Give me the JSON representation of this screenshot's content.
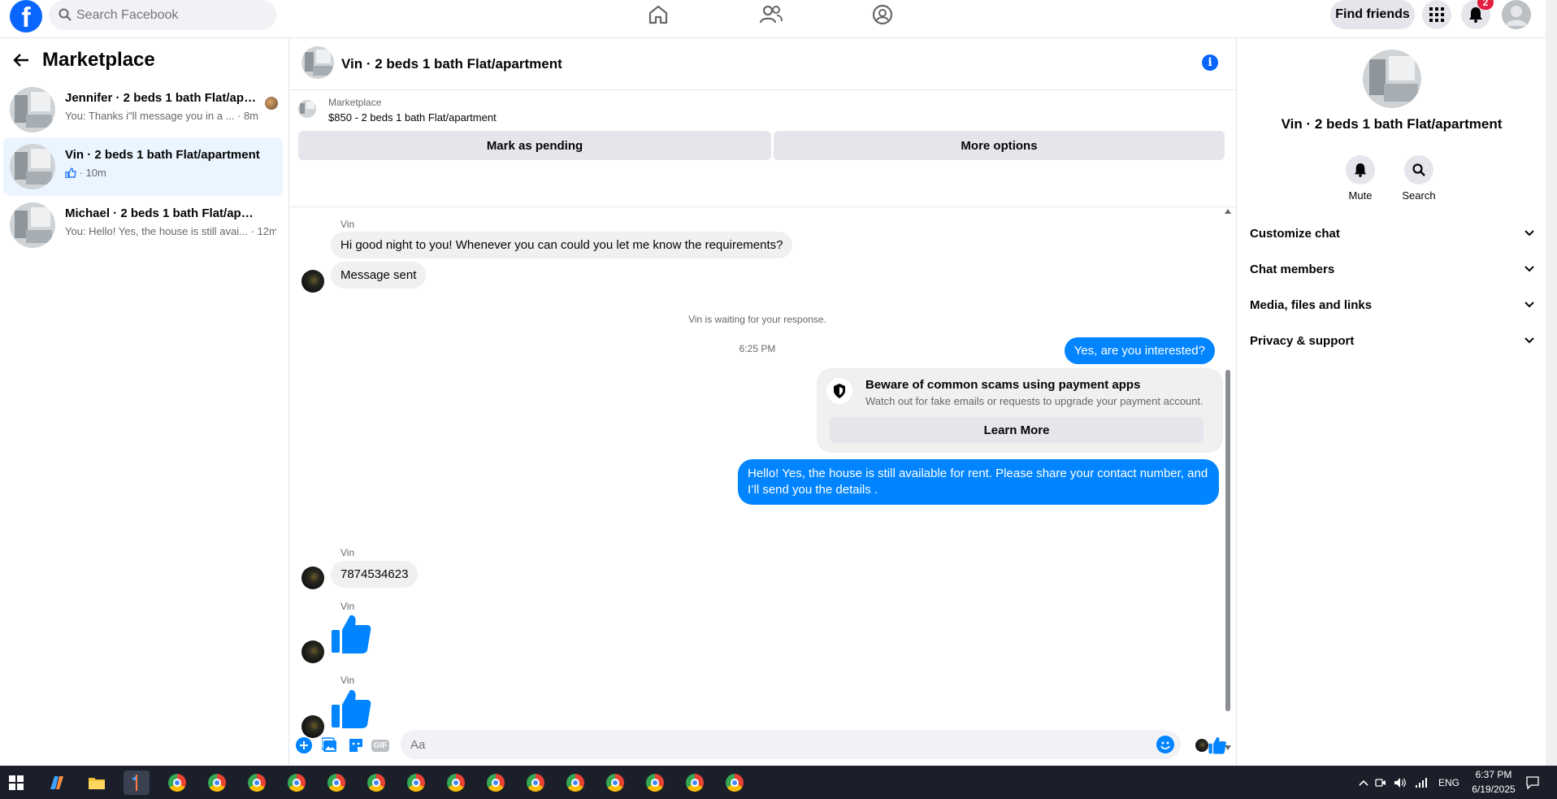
{
  "topbar": {
    "search_placeholder": "Search Facebook",
    "find_friends_label": "Find friends",
    "notification_count": "2"
  },
  "sidebar": {
    "back_title": "Marketplace",
    "conversations": [
      {
        "name": "Jennifer · 2 beds 1 bath Flat/apa...",
        "preview": "You: Thanks i\"ll message you in a ... · 8m"
      },
      {
        "name": "Vin · 2 beds 1 bath Flat/apartment",
        "preview": "· 10m"
      },
      {
        "name": "Michael · 2 beds 1 bath Flat/apart...",
        "preview": "You: Hello! Yes, the house is still avai... · 12m"
      }
    ]
  },
  "chat": {
    "title": "Vin · 2 beds 1 bath Flat/apartment",
    "listing_source": "Marketplace",
    "listing_title": "$850 - 2 beds 1 bath Flat/apartment",
    "mark_pending_label": "Mark as pending",
    "more_options_label": "More options",
    "messages": {
      "sender_name": "Vin",
      "msg1": "Hi good night to you! Whenever you can could you let me know the requirements?",
      "msg2": "Message sent",
      "waiting_note": "Vin is waiting for your response.",
      "timestamp": "6:25 PM",
      "out1": "Yes, are you interested?",
      "scam_title": "Beware of common scams using payment apps",
      "scam_text": "Watch out for fake emails or requests to upgrade your payment account.",
      "learn_more": "Learn More",
      "out2": "Hello! Yes, the house is still available for rent. Please share your contact number, and I’ll send you the details .",
      "msg3": "7874534623"
    },
    "composer_placeholder": "Aa",
    "gif_label": "GIF"
  },
  "right_panel": {
    "title": "Vin · 2 beds 1 bath Flat/apartment",
    "mute_label": "Mute",
    "search_label": "Search",
    "sections": [
      "Customize chat",
      "Chat members",
      "Media, files and links",
      "Privacy & support"
    ]
  },
  "taskbar": {
    "language": "ENG",
    "time": "6:37 PM",
    "date": "6/19/2025"
  },
  "colors": {
    "brand": "#0866ff",
    "outgoing_bubble": "#0084ff",
    "incoming_bubble": "#f0f0f0",
    "active_conv": "#ebf5ff"
  }
}
